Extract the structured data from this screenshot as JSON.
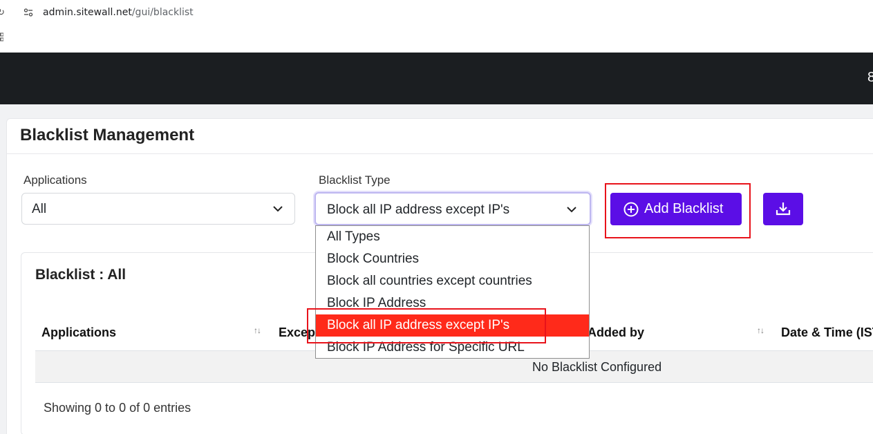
{
  "browser": {
    "url_host": "admin.sitewall.net",
    "url_path": "/gui/blacklist"
  },
  "page": {
    "title": "Blacklist Management"
  },
  "filters": {
    "applications_label": "Applications",
    "applications_value": "All",
    "blacklist_type_label": "Blacklist Type",
    "blacklist_type_value": "Block all IP address except IP's"
  },
  "buttons": {
    "add_blacklist": "Add Blacklist"
  },
  "dropdown": {
    "options": [
      "All Types",
      "Block Countries",
      "Block all countries except countries",
      "Block IP Address",
      "Block all IP address except IP's",
      "Block IP Address for Specific URL"
    ],
    "selected_index": 4
  },
  "table": {
    "title": "Blacklist : All",
    "columns": [
      "Applications",
      "Except",
      "Added by",
      "Date & Time (IST"
    ],
    "empty_message": "No Blacklist Configured",
    "entries_info": "Showing 0 to 0 of 0 entries"
  },
  "colors": {
    "accent": "#5b0ee6",
    "header_bg": "#1b1e21",
    "selected_option": "#ff2a1a",
    "annotation": "#e8121a"
  }
}
